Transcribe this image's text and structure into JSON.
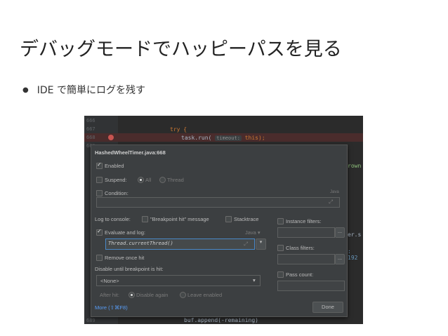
{
  "slide": {
    "title": "デバッグモードでハッピーパスを見る",
    "bullet": "IDE で簡単にログを残す"
  },
  "editor": {
    "line_numbers": [
      "666",
      "667",
      "668",
      "669"
    ],
    "bottom_line_number": "689",
    "code_try": "try {",
    "code_run_prefix": "task.run(",
    "code_run_hint": "timeout:",
    "code_run_suffix": "this);",
    "code_bottom": "buf.append(-remaining)",
    "right_fragments": [
      "rown",
      "er.s",
      ": 192"
    ]
  },
  "popup": {
    "title": "HashedWheelTimer.java:668",
    "enabled_label": "Enabled",
    "enabled_checked": true,
    "suspend_label": "Suspend:",
    "suspend_checked": false,
    "suspend_all_label": "All",
    "suspend_thread_label": "Thread",
    "condition_label": "Condition:",
    "condition_lang": "Java",
    "log_to_console_label": "Log to console:",
    "log_breakpoint_hit_label": "\"Breakpoint hit\" message",
    "log_stacktrace_label": "Stacktrace",
    "evaluate_label": "Evaluate and log:",
    "evaluate_checked": true,
    "evaluate_lang": "Java",
    "evaluate_expression": "Thread.currentThread()",
    "remove_once_hit_label": "Remove once hit",
    "disable_until_label": "Disable until breakpoint is hit:",
    "disable_until_value": "<None>",
    "after_hit_label": "After hit:",
    "disable_again_label": "Disable again",
    "leave_enabled_label": "Leave enabled",
    "instance_filters_label": "Instance filters:",
    "class_filters_label": "Class filters:",
    "pass_count_label": "Pass count:",
    "more_link": "More (⇧⌘F8)",
    "done_button": "Done",
    "browse_button": "..."
  },
  "colors": {
    "editor_bg": "#2b2b2b",
    "popup_bg": "#3c3f41",
    "breakpoint": "#c75450",
    "keyword": "#cc7832",
    "link": "#589df6"
  }
}
